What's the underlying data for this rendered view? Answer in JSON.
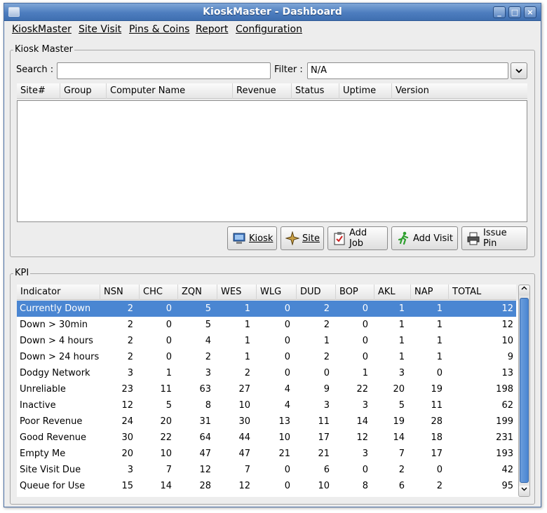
{
  "window": {
    "title": "KioskMaster - Dashboard",
    "controls": {
      "minimize": "_",
      "maximize": "□",
      "close": "×"
    }
  },
  "menu": [
    "KioskMaster",
    "Site Visit",
    "Pins & Coins",
    "Report",
    "Configuration"
  ],
  "kiosk_master": {
    "group_label": "Kiosk Master",
    "search_label": "Search :",
    "search_value": "",
    "filter_label": "Filter :",
    "filter_value": "N/A",
    "columns": [
      "Site#",
      "Group",
      "Computer Name",
      "Revenue",
      "Status",
      "Uptime",
      "Version"
    ],
    "buttons": {
      "kiosk": "Kiosk",
      "site": "Site",
      "add_job": "Add Job",
      "add_visit": "Add Visit",
      "issue_pin": "Issue Pin"
    }
  },
  "kpi": {
    "group_label": "KPI",
    "columns": [
      "Indicator",
      "NSN",
      "CHC",
      "ZQN",
      "WES",
      "WLG",
      "DUD",
      "BOP",
      "AKL",
      "NAP",
      "TOTAL"
    ],
    "selected_row": 0,
    "rows": [
      [
        "Currently Down",
        "2",
        "0",
        "5",
        "1",
        "0",
        "2",
        "0",
        "1",
        "1",
        "12"
      ],
      [
        "Down > 30min",
        "2",
        "0",
        "5",
        "1",
        "0",
        "2",
        "0",
        "1",
        "1",
        "12"
      ],
      [
        "Down > 4 hours",
        "2",
        "0",
        "4",
        "1",
        "0",
        "1",
        "0",
        "1",
        "1",
        "10"
      ],
      [
        "Down > 24 hours",
        "2",
        "0",
        "2",
        "1",
        "0",
        "2",
        "0",
        "1",
        "1",
        "9"
      ],
      [
        "Dodgy Network",
        "3",
        "1",
        "3",
        "2",
        "0",
        "0",
        "1",
        "3",
        "0",
        "13"
      ],
      [
        "Unreliable",
        "23",
        "11",
        "63",
        "27",
        "4",
        "9",
        "22",
        "20",
        "19",
        "198"
      ],
      [
        "Inactive",
        "12",
        "5",
        "8",
        "10",
        "4",
        "3",
        "3",
        "5",
        "11",
        "62"
      ],
      [
        "Poor Revenue",
        "24",
        "20",
        "31",
        "30",
        "13",
        "11",
        "14",
        "19",
        "28",
        "199"
      ],
      [
        "Good Revenue",
        "30",
        "22",
        "64",
        "44",
        "10",
        "17",
        "12",
        "14",
        "18",
        "231"
      ],
      [
        "Empty Me",
        "20",
        "10",
        "47",
        "47",
        "21",
        "21",
        "3",
        "7",
        "17",
        "193"
      ],
      [
        "Site Visit Due",
        "3",
        "7",
        "12",
        "7",
        "0",
        "6",
        "0",
        "2",
        "0",
        "42"
      ],
      [
        "Queue for Use",
        "15",
        "14",
        "28",
        "12",
        "0",
        "10",
        "8",
        "6",
        "2",
        "95"
      ]
    ]
  },
  "colors": {
    "title_bar": "#4d7dbf",
    "selection": "#4a86d2"
  }
}
